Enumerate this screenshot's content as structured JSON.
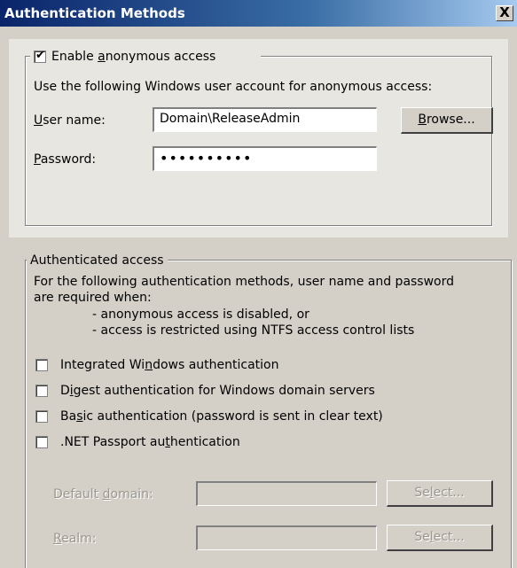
{
  "window": {
    "title": "Authentication Methods",
    "close_label": "X"
  },
  "anonymous": {
    "checkbox_label_pre": "Enable ",
    "checkbox_label_ul": "a",
    "checkbox_label_post": "nonymous access",
    "checked": true,
    "description": "Use the following Windows user account for anonymous access:",
    "username_label_ul": "U",
    "username_label_post": "ser name:",
    "username_value": "Domain\\ReleaseAdmin",
    "browse_ul": "B",
    "browse_post": "rowse...",
    "password_label_ul": "P",
    "password_label_post": "assword:",
    "password_value": "••••••••••"
  },
  "authenticated": {
    "group_label": "Authenticated access",
    "description_line1": "For the following authentication methods, user name and password",
    "description_line2": "are required when:",
    "bullet1": "- anonymous access is disabled, or",
    "bullet2": "- access is restricted using NTFS access control lists",
    "options": [
      {
        "pre": "Integrated Wi",
        "ul": "n",
        "post": "dows authentication",
        "checked": false
      },
      {
        "pre": "D",
        "ul": "i",
        "post": "gest authentication for Windows domain servers",
        "checked": false
      },
      {
        "pre": "Ba",
        "ul": "s",
        "post": "ic authentication (password is sent in clear text)",
        "checked": false
      },
      {
        "pre": ".NET Passport au",
        "ul": "t",
        "post": "hentication",
        "checked": false
      }
    ],
    "default_domain_pre": "Default ",
    "default_domain_ul": "d",
    "default_domain_post": "omain:",
    "default_domain_value": "",
    "realm_ul": "R",
    "realm_post": "ealm:",
    "realm_value": "",
    "select1_pre": "Se",
    "select1_ul": "l",
    "select1_post": "ect...",
    "select2_pre": "Se",
    "select2_ul": "l",
    "select2_post": "ect..."
  }
}
